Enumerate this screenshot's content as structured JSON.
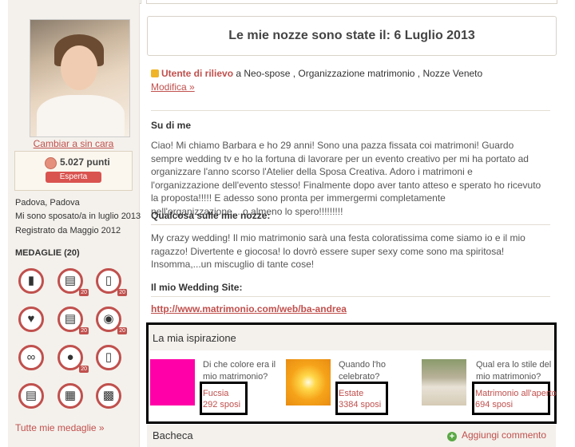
{
  "profile": {
    "change_face": "Cambiar a sin cara",
    "points": "5.027 punti",
    "rank": "Esperta",
    "location": "Padova, Padova",
    "married": "Mi sono sposato/a in luglio 2013",
    "registered": "Registrato da Maggio 2012"
  },
  "medals": {
    "title": "MEDAGLIE (20)",
    "badge_value": "20",
    "items": [
      {
        "icon": "cake-icon",
        "glyph": "▮",
        "badge": ""
      },
      {
        "icon": "calendar-icon",
        "glyph": "▤",
        "badge": "20"
      },
      {
        "icon": "phone-icon",
        "glyph": "▯",
        "badge": "20"
      },
      {
        "icon": "heart-icon",
        "glyph": "♥",
        "badge": ""
      },
      {
        "icon": "calendar-icon",
        "glyph": "▤",
        "badge": "20"
      },
      {
        "icon": "camera-icon",
        "glyph": "◉",
        "badge": "20"
      },
      {
        "icon": "glasses-icon",
        "glyph": "∞",
        "badge": ""
      },
      {
        "icon": "chat-bubble-icon",
        "glyph": "●",
        "badge": "20"
      },
      {
        "icon": "phone-icon",
        "glyph": "▯",
        "badge": ""
      },
      {
        "icon": "calendar-icon",
        "glyph": "▤",
        "badge": ""
      },
      {
        "icon": "clapperboard-icon",
        "glyph": "▦",
        "badge": ""
      },
      {
        "icon": "film-icon",
        "glyph": "▩",
        "badge": ""
      }
    ],
    "all_link": "Tutte mie medaglie »"
  },
  "main": {
    "title": "Le mie nozze sono state il: 6 Luglio 2013",
    "featured_label": "Utente di rilievo",
    "featured_rest": " a Neo-spose , Organizzazione matrimonio , Nozze Veneto",
    "edit": "Modifica »",
    "about_title": "Su di me",
    "about_text": "Ciao! Mi chiamo Barbara e ho 29 anni! Sono una pazza fissata coi matrimoni! Guardo sempre wedding tv e ho la fortuna di lavorare per un evento creativo per mi ha portato ad organizzare l'anno scorso l'Atelier della Sposa Creativa. Adoro i matrimoni e l'organizzazione dell'evento stesso! Finalmente dopo aver tanto atteso e sperato ho ricevuto la proposta!!!!! E adesso sono pronta per immergermi completamente nell'organizzazione....o almeno lo spero!!!!!!!!!",
    "wedding_title": "Qualcosa sulle mie nozze:",
    "wedding_text": "My crazy wedding! Il mio matrimonio sarà una festa coloratissima come siamo io e il mio ragazzo! Divertente e giocosa! lo dovrò essere super sexy come sono ma spiritosa! Insomma,...un miscuglio di tante cose!",
    "site_title": "Il mio Wedding Site:",
    "site_link": "http://www.matrimonio.com/web/ba-andrea"
  },
  "inspiration": {
    "title": "La mia ispirazione",
    "items": [
      {
        "question": "Di che colore era il mio matrimonio?",
        "answer": "Fucsia",
        "count": "292 sposi",
        "color": "#ff00a8"
      },
      {
        "question": "Quando l'ho celebrato?",
        "answer": "Estate",
        "count": "3384 sposi",
        "color": "#f6b21a"
      },
      {
        "question": "Qual era lo stile del mio matrimonio?",
        "answer": "Matrimonio all'aperto",
        "count": "694 sposi",
        "color": "#b8a890"
      }
    ]
  },
  "wall": {
    "title": "Bacheca",
    "add_comment": "Aggiungi commento"
  }
}
